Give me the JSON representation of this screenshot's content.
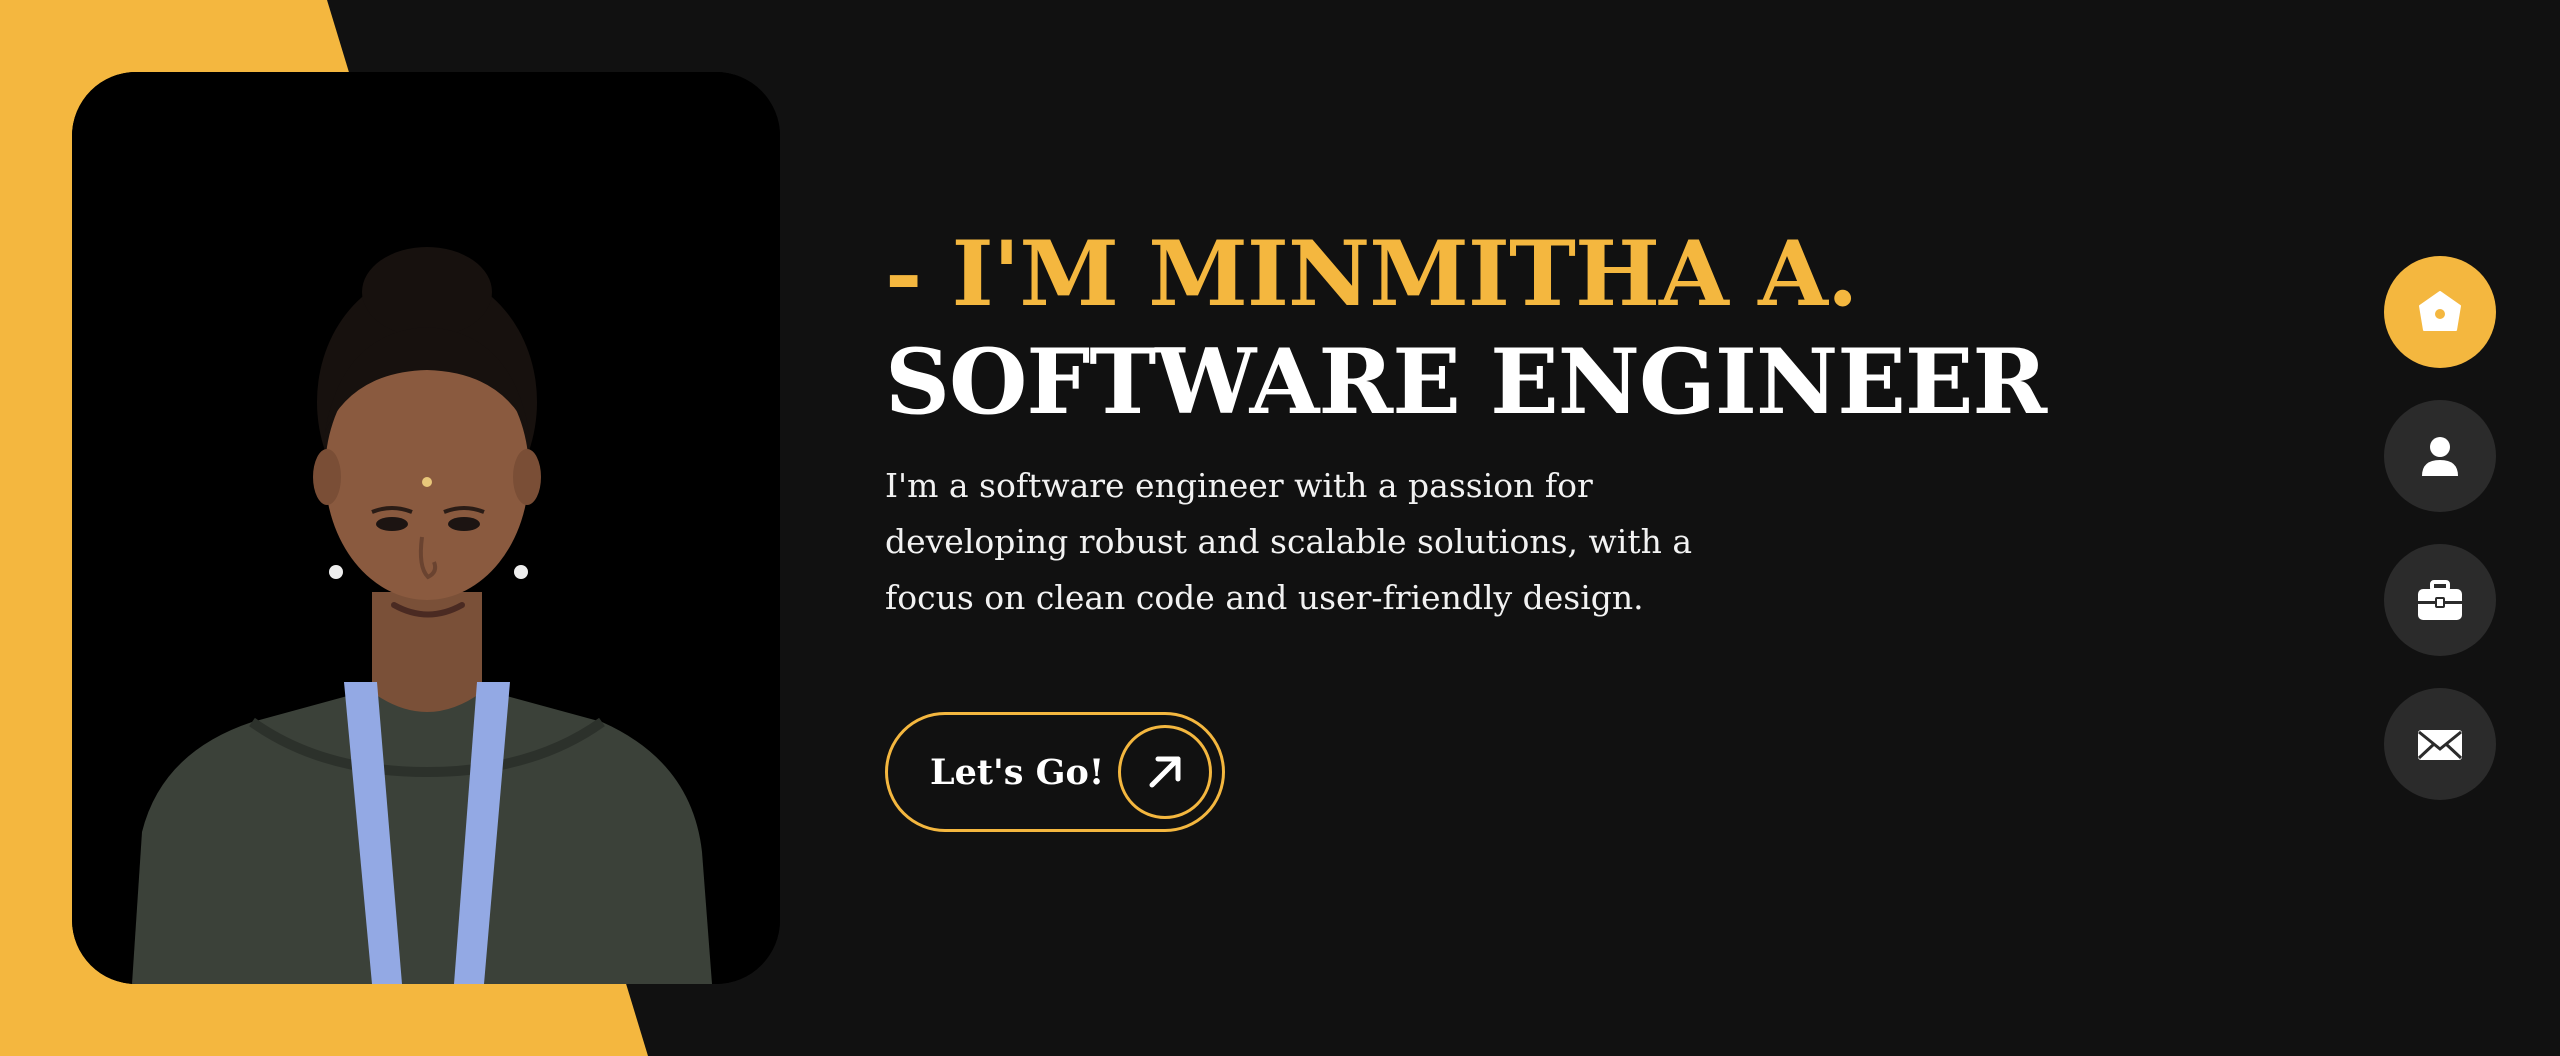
{
  "colors": {
    "accent": "#F4B73F",
    "background": "#111111",
    "text": "#FFFFFF",
    "nav_inactive": "#2B2B2B"
  },
  "hero": {
    "intro": "- I'M MINMITHA A.",
    "role": "SOFTWARE ENGINEER",
    "bio": "I'm a software engineer with a passion for developing robust and scalable solutions, with a focus on clean code and user-friendly design.",
    "cta_label": "Let's Go!"
  },
  "photo": {
    "alt": "profile-photo"
  },
  "nav": {
    "items": [
      {
        "name": "home",
        "icon": "home-icon",
        "active": true
      },
      {
        "name": "about",
        "icon": "user-icon",
        "active": false
      },
      {
        "name": "portfolio",
        "icon": "briefcase-icon",
        "active": false
      },
      {
        "name": "contact",
        "icon": "envelope-icon",
        "active": false
      }
    ]
  }
}
